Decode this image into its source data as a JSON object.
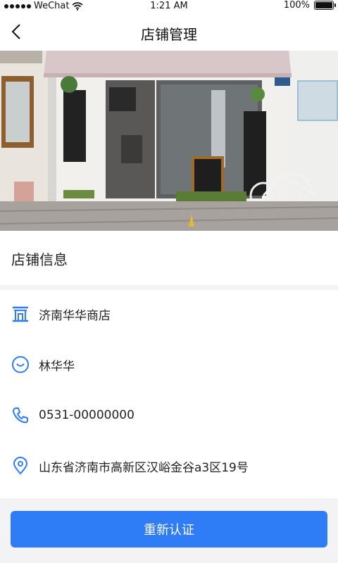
{
  "status_bar": {
    "carrier": "WeChat",
    "time": "1:21 AM",
    "battery": "100%"
  },
  "nav": {
    "title": "店铺管理",
    "back_icon": "chevron-left-icon"
  },
  "hero": {
    "image": "storefront-photo"
  },
  "section": {
    "title": "店铺信息"
  },
  "store": {
    "name": "济南华华商店",
    "owner": "林华华",
    "phone": "0531-00000000",
    "address": "山东省济南市高新区汉峪金谷a3区19号"
  },
  "icons": {
    "store": "store-icon",
    "user": "smiley-user-icon",
    "phone": "phone-icon",
    "location": "location-pin-icon"
  },
  "actions": {
    "reauth_label": "重新认证"
  },
  "colors": {
    "accent": "#2e7cf6",
    "page_bg": "#f3f3f5"
  }
}
